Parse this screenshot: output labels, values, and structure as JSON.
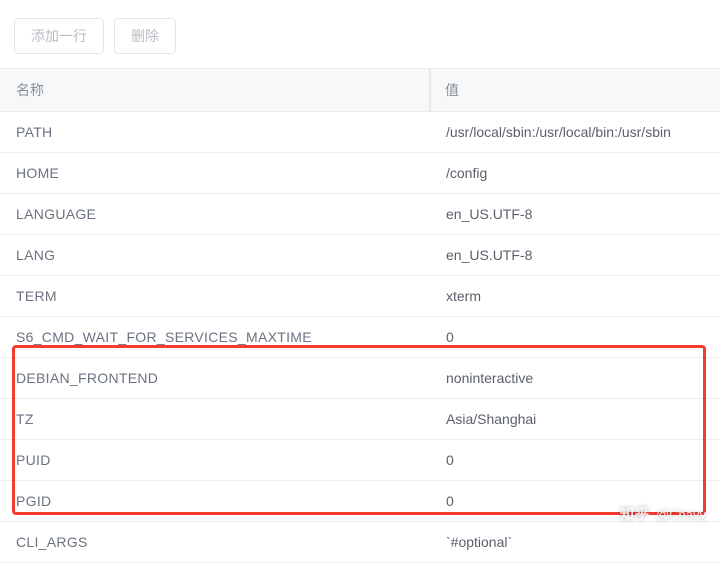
{
  "toolbar": {
    "add_row_label": "添加一行",
    "delete_label": "删除"
  },
  "table": {
    "columns": {
      "name": "名称",
      "value": "值"
    },
    "rows": [
      {
        "name": "PATH",
        "value": "/usr/local/sbin:/usr/local/bin:/usr/sbin"
      },
      {
        "name": "HOME",
        "value": "/config"
      },
      {
        "name": "LANGUAGE",
        "value": "en_US.UTF-8"
      },
      {
        "name": "LANG",
        "value": "en_US.UTF-8"
      },
      {
        "name": "TERM",
        "value": "xterm"
      },
      {
        "name": "S6_CMD_WAIT_FOR_SERVICES_MAXTIME",
        "value": "0"
      },
      {
        "name": "DEBIAN_FRONTEND",
        "value": "noninteractive"
      },
      {
        "name": "TZ",
        "value": "Asia/Shanghai"
      },
      {
        "name": "PUID",
        "value": "0"
      },
      {
        "name": "PGID",
        "value": "0"
      },
      {
        "name": "CLI_ARGS",
        "value": "`#optional`"
      }
    ]
  },
  "watermark": {
    "brand": "知乎",
    "user": "@Chavy"
  }
}
